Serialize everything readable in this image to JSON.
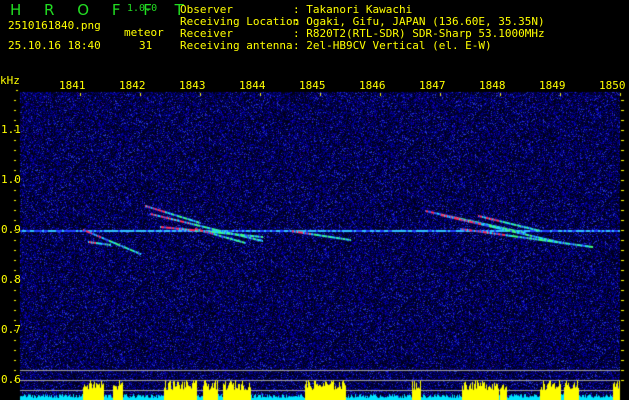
{
  "app": {
    "name": "H R O F F T",
    "version": "1.0.0"
  },
  "file": {
    "name": "2510161840.png",
    "datetime": "25.10.16 18:40"
  },
  "meteor": {
    "label": "meteor",
    "count": "31"
  },
  "info": [
    {
      "label": "Observer",
      "value": ": Takanori Kawachi"
    },
    {
      "label": "Receiving Location",
      "value": ": Ogaki, Gifu, JAPAN (136.60E, 35.35N)"
    },
    {
      "label": "Receiver",
      "value": ": R820T2(RTL-SDR) SDR-Sharp 53.1000MHz"
    },
    {
      "label": "Receiving antenna",
      "value": ": 2el-HB9CV Vertical (el. E-W)"
    }
  ],
  "axes": {
    "y_unit": "kHz",
    "x_ticks": [
      "1841",
      "1842",
      "1843",
      "1844",
      "1845",
      "1846",
      "1847",
      "1848",
      "1849",
      "1850"
    ],
    "y_ticks": [
      "1.1",
      "1.0",
      "0.9",
      "0.8",
      "0.7",
      "0.6"
    ]
  },
  "colors": {
    "text": "#ffff00",
    "logo": "#22dd22",
    "noise": "#1020c0",
    "level_high": "#ffff00",
    "level_low": "#00e5ff"
  }
}
